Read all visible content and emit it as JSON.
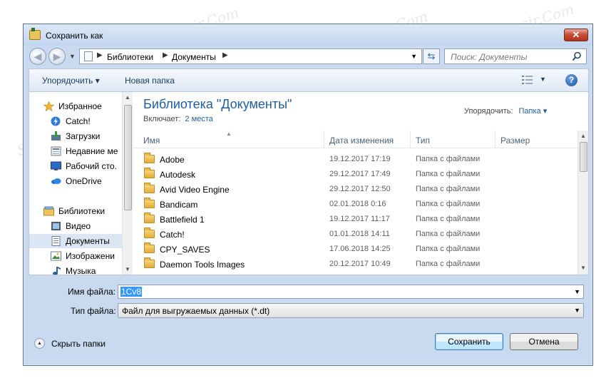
{
  "window": {
    "title": "Сохранить как",
    "close_label": "✕"
  },
  "navbar": {
    "breadcrumbs": [
      "Библиотеки",
      "Документы"
    ],
    "search_placeholder": "Поиск: Документы"
  },
  "toolbar": {
    "organize_label": "Упорядочить ▾",
    "new_folder_label": "Новая папка",
    "help_label": "?"
  },
  "navpane": {
    "items": [
      {
        "label": "Избранное",
        "icon": "star-icon"
      },
      {
        "label": "Catch!",
        "icon": "catch-icon"
      },
      {
        "label": "Загрузки",
        "icon": "downloads-icon"
      },
      {
        "label": "Недавние ме",
        "icon": "recent-places-icon"
      },
      {
        "label": "Рабочий сто.",
        "icon": "desktop-icon"
      },
      {
        "label": "OneDrive",
        "icon": "onedrive-icon"
      },
      {
        "label": "Библиотеки",
        "icon": "libraries-icon"
      },
      {
        "label": "Видео",
        "icon": "video-icon"
      },
      {
        "label": "Документы",
        "icon": "documents-icon"
      },
      {
        "label": "Изображени",
        "icon": "pictures-icon"
      },
      {
        "label": "Музыка",
        "icon": "music-icon"
      }
    ]
  },
  "library": {
    "title": "Библиотека \"Документы\"",
    "includes_label": "Включает:",
    "includes_link": "2 места",
    "arrange_label": "Упорядочить:",
    "arrange_value": "Папка ▾"
  },
  "columns": {
    "name": "Имя",
    "date": "Дата изменения",
    "type": "Тип",
    "size": "Размер"
  },
  "files": [
    {
      "name": "Adobe",
      "date": "19.12.2017 17:19",
      "type": "Папка с файлами"
    },
    {
      "name": "Autodesk",
      "date": "29.12.2017 17:49",
      "type": "Папка с файлами"
    },
    {
      "name": "Avid Video Engine",
      "date": "29.12.2017 12:50",
      "type": "Папка с файлами"
    },
    {
      "name": "Bandicam",
      "date": "02.01.2018 0:16",
      "type": "Папка с файлами"
    },
    {
      "name": "Battlefield 1",
      "date": "19.12.2017 11:17",
      "type": "Папка с файлами"
    },
    {
      "name": "Catch!",
      "date": "01.01.2018 14:11",
      "type": "Папка с файлами"
    },
    {
      "name": "CPY_SAVES",
      "date": "17.06.2018 14:25",
      "type": "Папка с файлами"
    },
    {
      "name": "Daemon Tools Images",
      "date": "20.12.2017 10:49",
      "type": "Папка с файлами"
    }
  ],
  "form": {
    "filename_label": "Имя файла:",
    "filename_value": "1Cv8",
    "filetype_label": "Тип файла:",
    "filetype_value": "Файл для выгружаемых данных (*.dt)"
  },
  "footer": {
    "hide_folders_label": "Скрыть папки",
    "save_label": "Сохранить",
    "cancel_label": "Отмена"
  },
  "watermark": "Soringpcrepair.Com",
  "colors": {
    "accent": "#1e5d9e",
    "window_frame": "#c9daf0",
    "selection": "#3399ff"
  }
}
